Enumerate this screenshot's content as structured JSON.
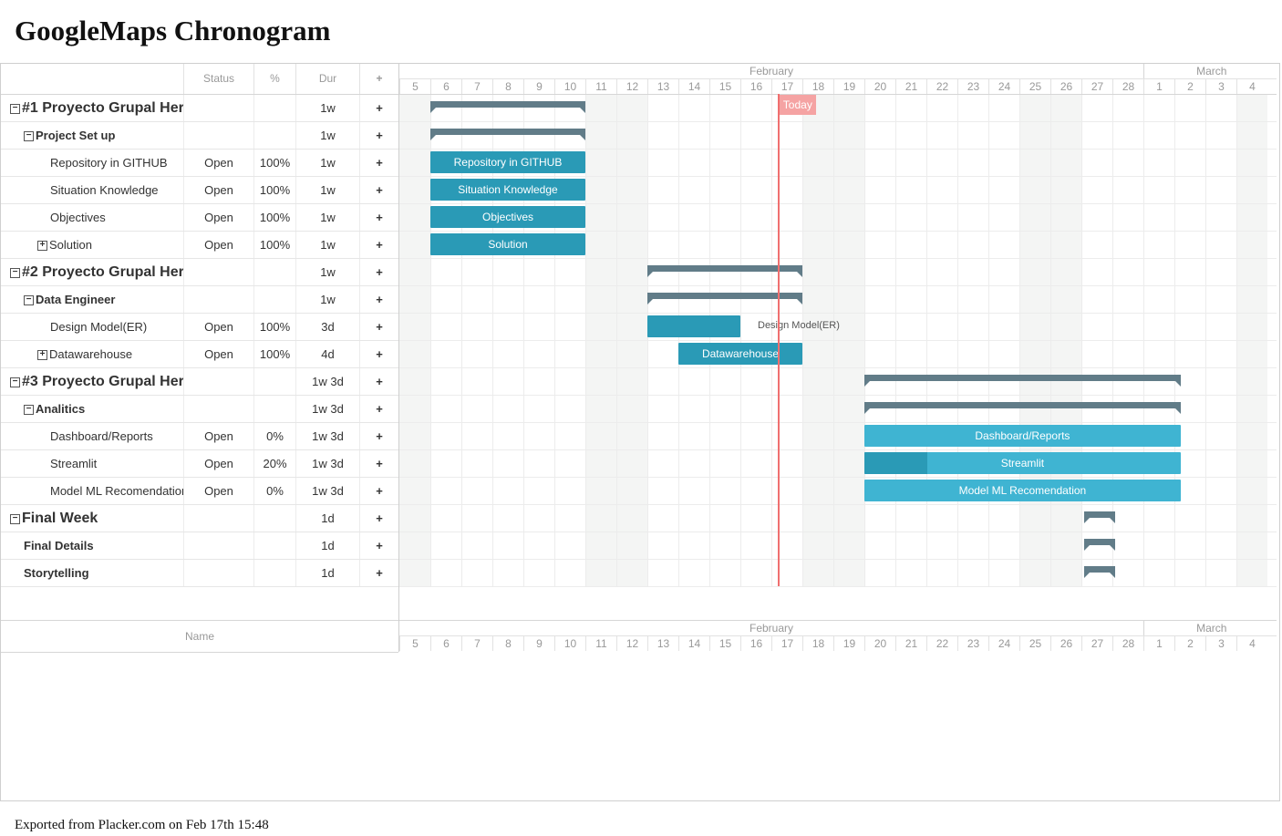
{
  "title": "GoogleMaps Chronogram",
  "footer": "Exported from Placker.com on Feb 17th 15:48",
  "grid": {
    "headers": {
      "name": "",
      "status": "Status",
      "percent": "%",
      "duration": "Dur",
      "add": "+"
    },
    "footer_name": "Name"
  },
  "rows": [
    {
      "name": "#1 Proyecto Grupal Her",
      "level": 0,
      "toggle": "−",
      "status": "",
      "percent": "",
      "dur": "1w"
    },
    {
      "name": "Project Set up",
      "level": 1,
      "toggle": "−",
      "status": "",
      "percent": "",
      "dur": "1w"
    },
    {
      "name": "Repository in GITHUB",
      "level": 2,
      "toggle": "",
      "status": "Open",
      "percent": "100%",
      "dur": "1w"
    },
    {
      "name": "Situation Knowledge",
      "level": 2,
      "toggle": "",
      "status": "Open",
      "percent": "100%",
      "dur": "1w"
    },
    {
      "name": "Objectives",
      "level": 2,
      "toggle": "",
      "status": "Open",
      "percent": "100%",
      "dur": "1w"
    },
    {
      "name": "Solution",
      "level": 2,
      "toggle": "+",
      "status": "Open",
      "percent": "100%",
      "dur": "1w"
    },
    {
      "name": "#2 Proyecto Grupal Her",
      "level": 0,
      "toggle": "−",
      "status": "",
      "percent": "",
      "dur": "1w"
    },
    {
      "name": "Data Engineer",
      "level": 1,
      "toggle": "−",
      "status": "",
      "percent": "",
      "dur": "1w"
    },
    {
      "name": "Design Model(ER)",
      "level": 2,
      "toggle": "",
      "status": "Open",
      "percent": "100%",
      "dur": "3d"
    },
    {
      "name": "Datawarehouse",
      "level": 2,
      "toggle": "+",
      "status": "Open",
      "percent": "100%",
      "dur": "4d"
    },
    {
      "name": "#3 Proyecto Grupal Her",
      "level": 0,
      "toggle": "−",
      "status": "",
      "percent": "",
      "dur": "1w 3d"
    },
    {
      "name": "Analitics",
      "level": 1,
      "toggle": "−",
      "status": "",
      "percent": "",
      "dur": "1w 3d"
    },
    {
      "name": "Dashboard/Reports",
      "level": 2,
      "toggle": "",
      "status": "Open",
      "percent": "0%",
      "dur": "1w 3d"
    },
    {
      "name": "Streamlit",
      "level": 2,
      "toggle": "",
      "status": "Open",
      "percent": "20%",
      "dur": "1w 3d"
    },
    {
      "name": "Model ML Recomendation",
      "level": 2,
      "toggle": "",
      "status": "Open",
      "percent": "0%",
      "dur": "1w 3d"
    },
    {
      "name": "Final Week",
      "level": 0,
      "toggle": "−",
      "status": "",
      "percent": "",
      "dur": "1d"
    },
    {
      "name": "Final Details",
      "level": 1,
      "toggle": "",
      "status": "",
      "percent": "",
      "dur": "1d"
    },
    {
      "name": "Storytelling",
      "level": 1,
      "toggle": "",
      "status": "",
      "percent": "",
      "dur": "1d"
    }
  ],
  "timeline": {
    "months": [
      {
        "label": "February",
        "start": 0,
        "end": 24
      },
      {
        "label": "March",
        "start": 24,
        "end": 28.4
      }
    ],
    "days": [
      "5",
      "6",
      "7",
      "8",
      "9",
      "10",
      "11",
      "12",
      "13",
      "14",
      "15",
      "16",
      "17",
      "18",
      "19",
      "20",
      "21",
      "22",
      "23",
      "24",
      "25",
      "26",
      "27",
      "28",
      "1",
      "2",
      "3",
      "4"
    ],
    "weekends": [
      0,
      6,
      7,
      13,
      14,
      20,
      21,
      27
    ],
    "today_label": "Today",
    "today_offset": 12.2
  },
  "bars": [
    {
      "row": 0,
      "type": "summary",
      "start": 1,
      "end": 6
    },
    {
      "row": 1,
      "type": "summary",
      "start": 1,
      "end": 6
    },
    {
      "row": 2,
      "type": "task",
      "start": 1,
      "end": 6,
      "progress": 1,
      "label": "Repository in GITHUB"
    },
    {
      "row": 3,
      "type": "task",
      "start": 1,
      "end": 6,
      "progress": 1,
      "label": "Situation Knowledge"
    },
    {
      "row": 4,
      "type": "task",
      "start": 1,
      "end": 6,
      "progress": 1,
      "label": "Objectives"
    },
    {
      "row": 5,
      "type": "task",
      "start": 1,
      "end": 6,
      "progress": 1,
      "label": "Solution"
    },
    {
      "row": 6,
      "type": "summary",
      "start": 8,
      "end": 13
    },
    {
      "row": 7,
      "type": "summary",
      "start": 8,
      "end": 13
    },
    {
      "row": 8,
      "type": "task",
      "start": 8,
      "end": 11,
      "progress": 1,
      "label": "",
      "outside_label": "Design Model(ER)"
    },
    {
      "row": 9,
      "type": "task",
      "start": 9,
      "end": 13,
      "progress": 1,
      "label": "Datawarehouse"
    },
    {
      "row": 10,
      "type": "summary",
      "start": 15,
      "end": 25.2
    },
    {
      "row": 11,
      "type": "summary",
      "start": 15,
      "end": 25.2
    },
    {
      "row": 12,
      "type": "task",
      "start": 15,
      "end": 25.2,
      "progress": 0,
      "label": "Dashboard/Reports"
    },
    {
      "row": 13,
      "type": "task",
      "start": 15,
      "end": 25.2,
      "progress": 0.2,
      "label": "Streamlit"
    },
    {
      "row": 14,
      "type": "task",
      "start": 15,
      "end": 25.2,
      "progress": 0,
      "label": "Model ML Recomendation"
    },
    {
      "row": 15,
      "type": "summary",
      "start": 22.1,
      "end": 23.1
    },
    {
      "row": 16,
      "type": "summary",
      "start": 22.1,
      "end": 23.1
    },
    {
      "row": 17,
      "type": "summary",
      "start": 22.1,
      "end": 23.1
    }
  ],
  "colors": {
    "task": "#2a9ab6",
    "task_future": "#3fb4d2",
    "summary": "#617c88",
    "today": "#f06f6f",
    "weekend": "#f4f5f4"
  }
}
